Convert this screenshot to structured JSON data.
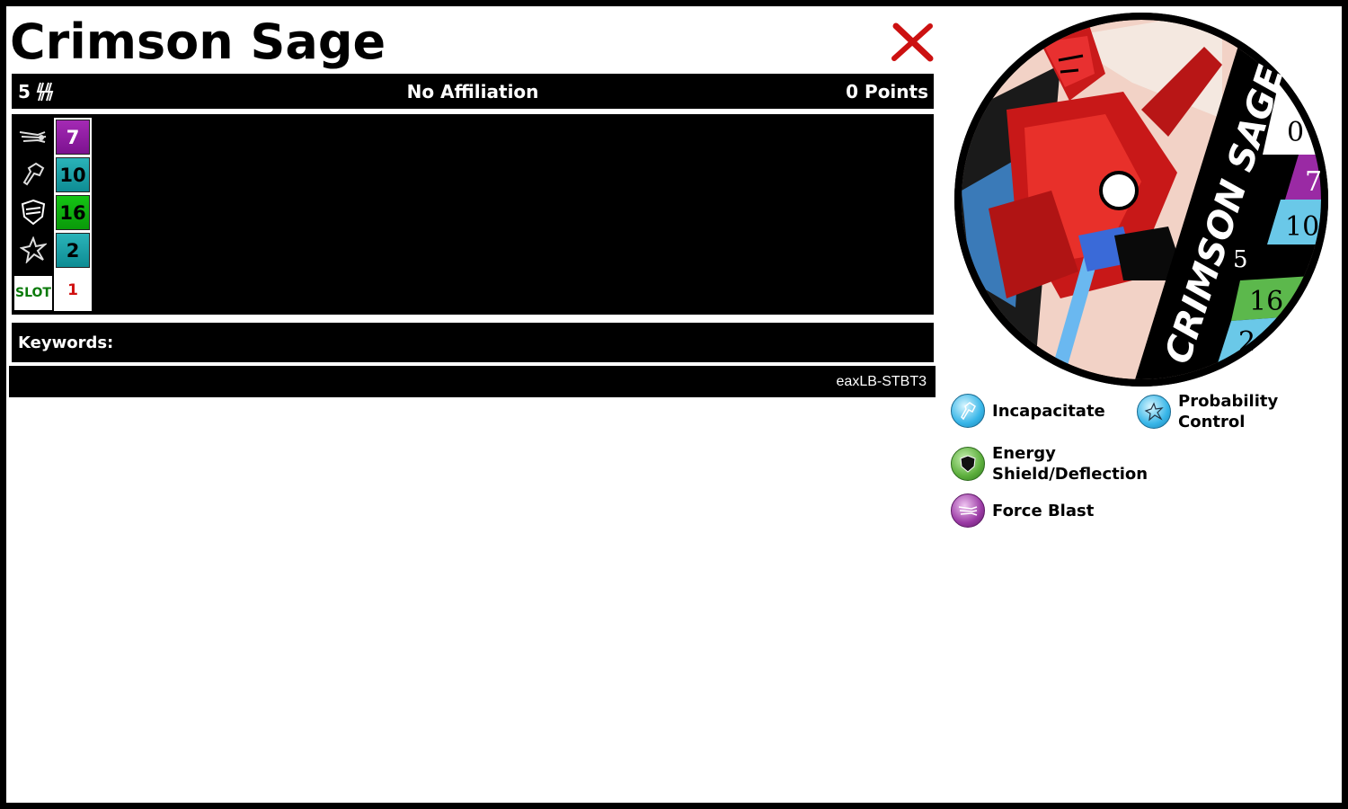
{
  "card": {
    "title": "Crimson Sage",
    "range": "5",
    "affiliation": "No Affiliation",
    "points": "0 Points",
    "keywords_label": "Keywords:",
    "code": "eaxLB-STBT3"
  },
  "dial": {
    "stats": [
      {
        "icon": "force-blast-speed-icon",
        "value": "7",
        "color": "#9b1fad"
      },
      {
        "icon": "fist-attack-icon",
        "value": "10",
        "color": "#1aa3aa"
      },
      {
        "icon": "shield-defense-icon",
        "value": "16",
        "color": "#10b510"
      },
      {
        "icon": "starburst-damage-icon",
        "value": "2",
        "color": "#1aa3aa"
      }
    ],
    "slot_label": "SLOT",
    "slot_value": "1"
  },
  "token": {
    "name_text": "CRIMSON SAGE",
    "values": [
      "0",
      "7",
      "10",
      "5",
      "16",
      "2"
    ]
  },
  "powers": [
    {
      "name": "Incapacitate",
      "icon": "incapacitate-icon",
      "color": "#38b6e8"
    },
    {
      "name_lines": [
        "Probability",
        "Control"
      ],
      "icon": "probability-control-icon",
      "color": "#38b6e8"
    },
    {
      "name_lines": [
        "Energy",
        "Shield/Deflection"
      ],
      "icon": "energy-shield-icon",
      "color": "#5cae3c"
    },
    {
      "name": "Force Blast",
      "icon": "force-blast-icon",
      "color": "#9a3aa4"
    }
  ],
  "colors": {
    "close": "#cc1111",
    "bar": "#000000",
    "slot_text": "#0a7a0a",
    "slot_value": "#d01010"
  }
}
